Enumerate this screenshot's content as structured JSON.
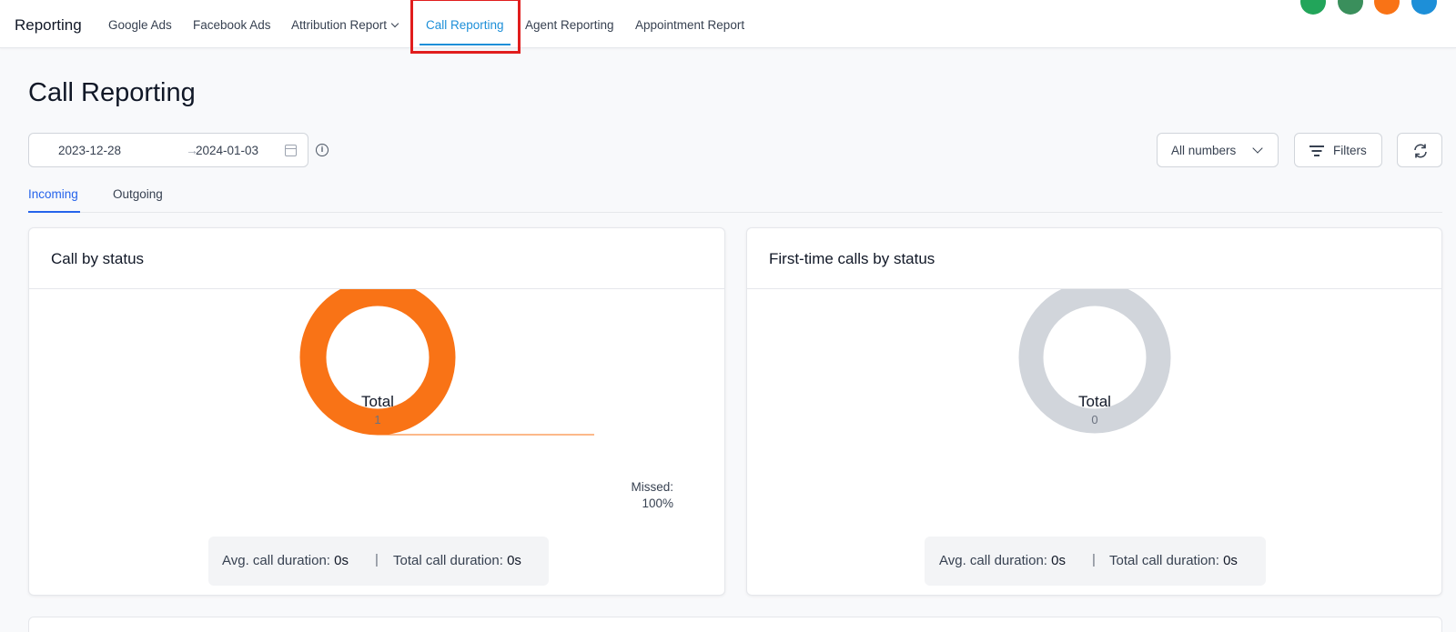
{
  "nav": {
    "brand": "Reporting",
    "items": [
      {
        "label": "Google Ads"
      },
      {
        "label": "Facebook Ads"
      },
      {
        "label": "Attribution Report"
      },
      {
        "label": "Call Reporting"
      },
      {
        "label": "Agent Reporting"
      },
      {
        "label": "Appointment Report"
      }
    ],
    "active_index": 3,
    "avatar_colors": [
      "#22a55a",
      "#3a8f5c",
      "#f97316",
      "#1d8fd8"
    ]
  },
  "page": {
    "title": "Call Reporting"
  },
  "date_range": {
    "start": "2023-12-28",
    "end": "2024-01-03",
    "arrow": "→"
  },
  "controls": {
    "numbers_select": "All numbers",
    "filters_label": "Filters"
  },
  "tabs": [
    {
      "label": "Incoming",
      "active": true
    },
    {
      "label": "Outgoing",
      "active": false
    }
  ],
  "cards": [
    {
      "title": "Call by status",
      "total_label": "Total",
      "total_value": "1",
      "ring_color": "#f97316",
      "legend_label": "Missed:",
      "legend_value": "100%",
      "avg_label": "Avg. call duration: ",
      "avg_value": "0s",
      "total_dur_label": "Total call duration: ",
      "total_dur_value": "0s"
    },
    {
      "title": "First-time calls by status",
      "total_label": "Total",
      "total_value": "0",
      "ring_color": "#d1d5db",
      "avg_label": "Avg. call duration: ",
      "avg_value": "0s",
      "total_dur_label": "Total call duration: ",
      "total_dur_value": "0s"
    }
  ],
  "chart_data": [
    {
      "type": "pie",
      "title": "Call by status",
      "categories": [
        "Missed"
      ],
      "values": [
        1
      ]
    },
    {
      "type": "pie",
      "title": "First-time calls by status",
      "categories": [],
      "values": []
    }
  ],
  "summary_separator": "|"
}
